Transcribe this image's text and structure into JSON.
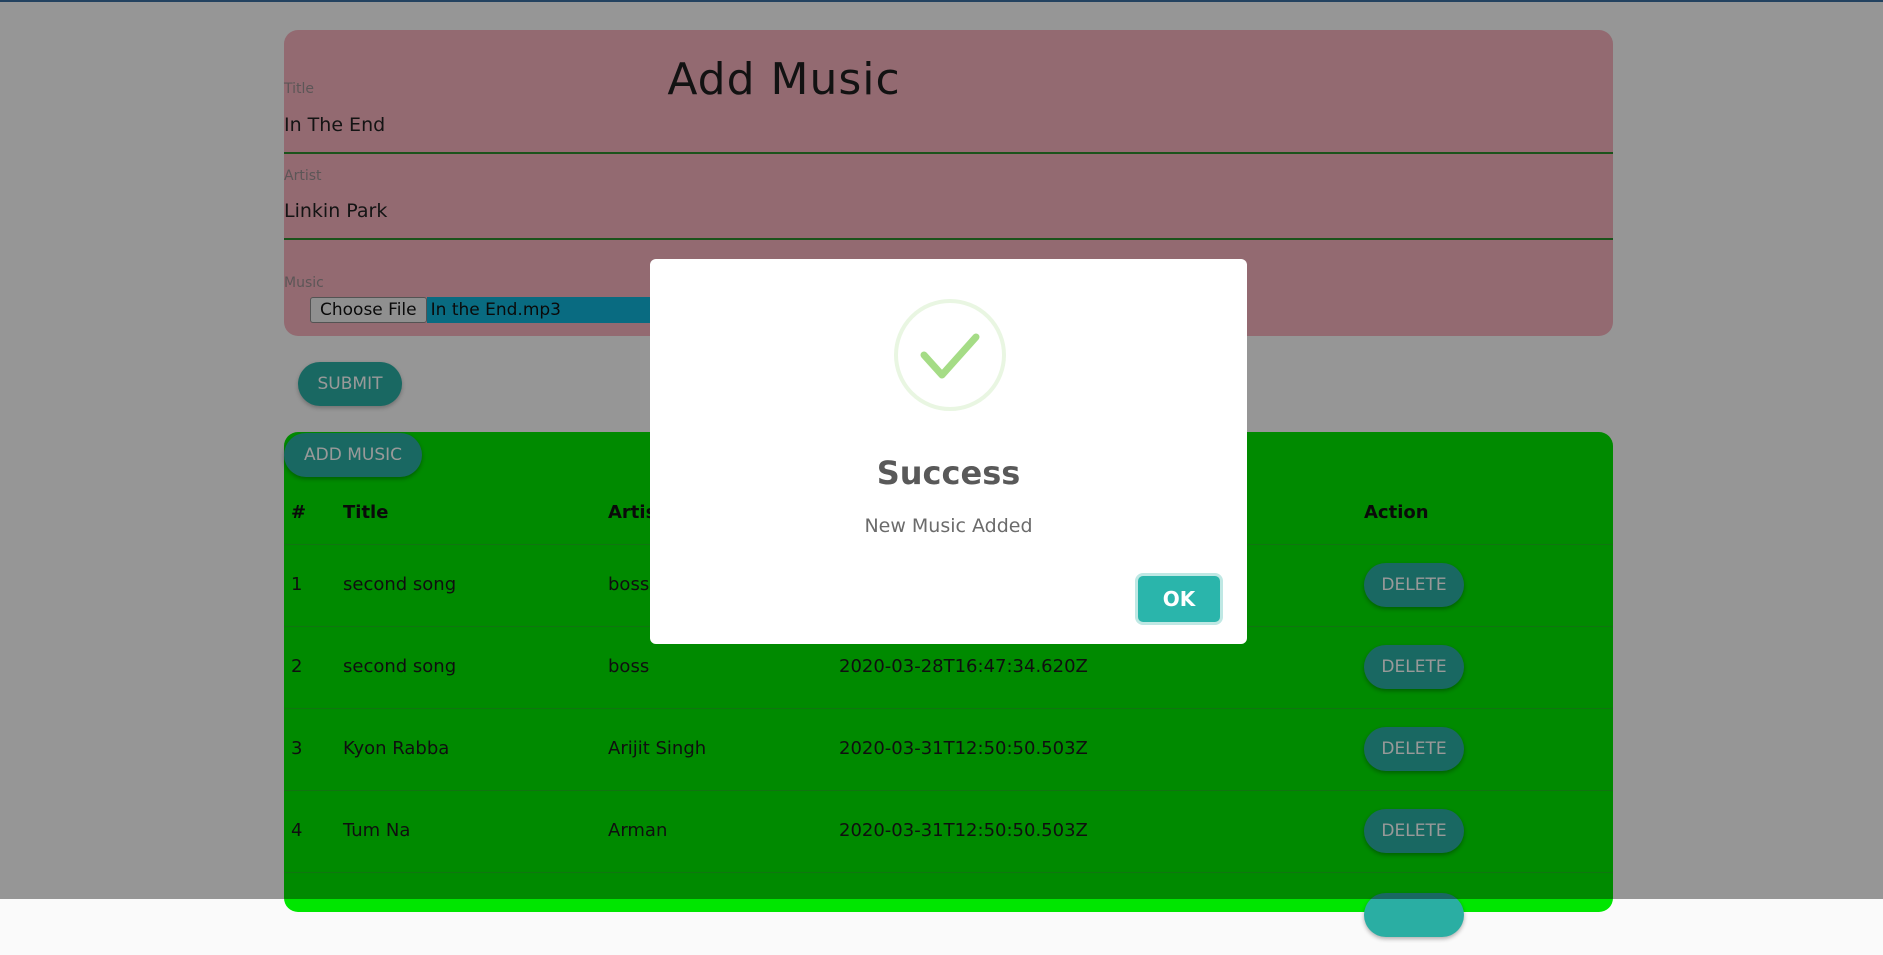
{
  "form": {
    "title": "Add Music",
    "title_field": {
      "label": "Title",
      "value": "In The End"
    },
    "artist_field": {
      "label": "Artist",
      "value": "Linkin Park"
    },
    "music_field": {
      "label": "Music",
      "choose_label": "Choose File",
      "file_name": "In the End.mp3"
    },
    "submit_label": "SUBMIT"
  },
  "table": {
    "add_button_label": "ADD MUSIC",
    "headers": [
      "#",
      "Title",
      "Artis",
      "Action"
    ],
    "rows": [
      {
        "num": "1",
        "title": "second song",
        "artist": "boss",
        "date": "",
        "action": "DELETE"
      },
      {
        "num": "2",
        "title": "second song",
        "artist": "boss",
        "date": "2020-03-28T16:47:34.620Z",
        "action": "DELETE"
      },
      {
        "num": "3",
        "title": "Kyon Rabba",
        "artist": "Arijit Singh",
        "date": "2020-03-31T12:50:50.503Z",
        "action": "DELETE"
      },
      {
        "num": "4",
        "title": "Tum Na",
        "artist": "Arman",
        "date": "2020-03-31T12:50:50.503Z",
        "action": "DELETE"
      }
    ]
  },
  "modal": {
    "icon": "checkmark-icon",
    "title": "Success",
    "text": "New Music Added",
    "ok_label": "OK"
  },
  "colors": {
    "form_bg": "#f5b1bd",
    "table_bg": "#00e600",
    "button": "#2aaea3",
    "success_check": "#a5dc86"
  }
}
